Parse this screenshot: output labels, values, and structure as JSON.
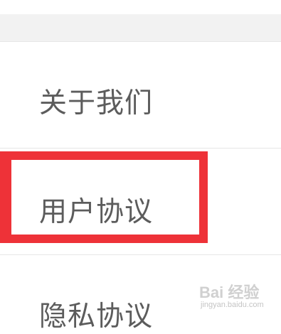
{
  "menu": {
    "items": [
      {
        "label": "关于我们"
      },
      {
        "label": "用户协议"
      },
      {
        "label": "隐私协议"
      }
    ]
  },
  "colors": {
    "highlight": "#ee3238",
    "label": "#5c5c5c",
    "band": "#f2f2f2"
  },
  "watermark": {
    "text": "Bai 经验",
    "url": "jingyan.baidu.com"
  }
}
